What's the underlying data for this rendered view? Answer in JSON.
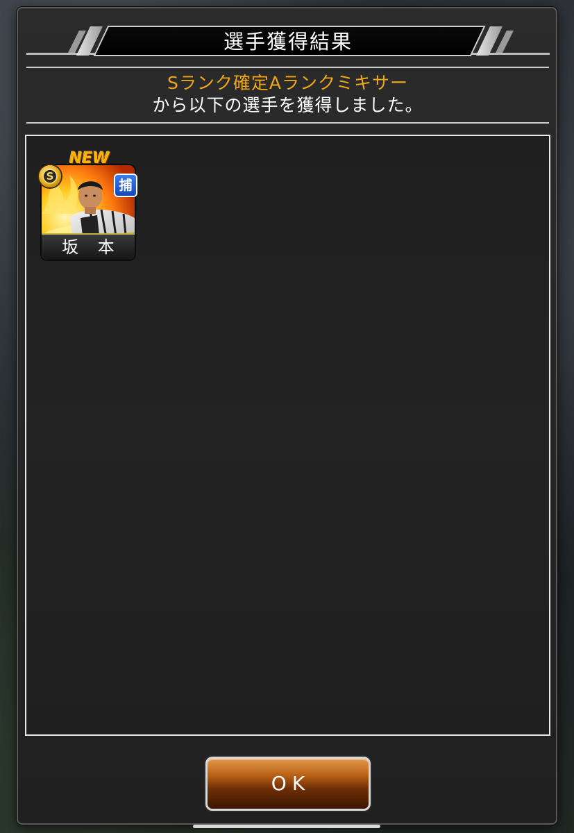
{
  "dialog": {
    "title": "選手獲得結果",
    "mixer_name": "Sランク確定Aランクミキサー",
    "message": "から以下の選手を獲得しました。"
  },
  "players": [
    {
      "name": "坂 本",
      "rank": "S",
      "new_label": "NEW",
      "position": "捕"
    }
  ],
  "buttons": {
    "ok_label": "OK"
  },
  "colors": {
    "mixer_name": "#f0a818",
    "ok_button": "#b55d14",
    "position_badge": "#1448b8"
  }
}
